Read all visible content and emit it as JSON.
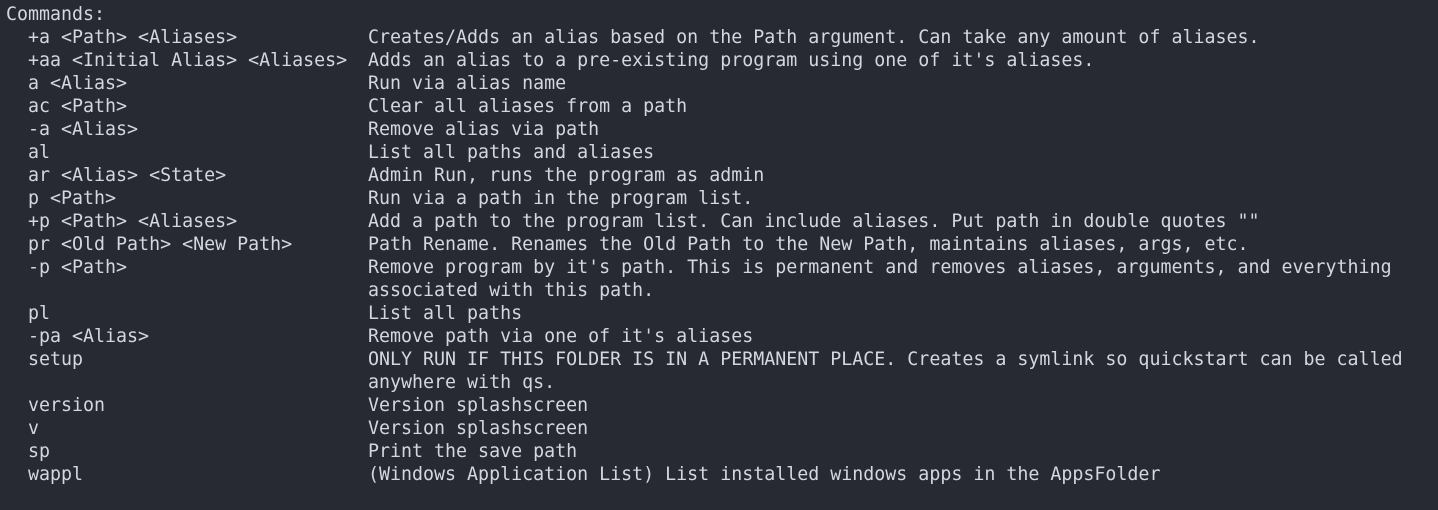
{
  "terminal": {
    "heading": "Commands:",
    "commands": [
      {
        "cmd": "+a <Path> <Aliases>",
        "desc": [
          "Creates/Adds an alias based on the Path argument. Can take any amount of aliases."
        ]
      },
      {
        "cmd": "+aa <Initial Alias> <Aliases>",
        "desc": [
          "Adds an alias to a pre-existing program using one of it's aliases."
        ]
      },
      {
        "cmd": "a <Alias>",
        "desc": [
          "Run via alias name"
        ]
      },
      {
        "cmd": "ac <Path>",
        "desc": [
          "Clear all aliases from a path"
        ]
      },
      {
        "cmd": "-a <Alias>",
        "desc": [
          "Remove alias via path"
        ]
      },
      {
        "cmd": "al",
        "desc": [
          "List all paths and aliases"
        ]
      },
      {
        "cmd": "ar <Alias> <State>",
        "desc": [
          "Admin Run, runs the program as admin"
        ]
      },
      {
        "cmd": "p <Path>",
        "desc": [
          "Run via a path in the program list."
        ]
      },
      {
        "cmd": "+p <Path> <Aliases>",
        "desc": [
          "Add a path to the program list. Can include aliases. Put path in double quotes \"\""
        ]
      },
      {
        "cmd": "pr <Old Path> <New Path>",
        "desc": [
          "Path Rename. Renames the Old Path to the New Path, maintains aliases, args, etc."
        ]
      },
      {
        "cmd": "-p <Path>",
        "desc": [
          "Remove program by it's path. This is permanent and removes aliases, arguments, and everything",
          "associated with this path."
        ]
      },
      {
        "cmd": "pl",
        "desc": [
          "List all paths"
        ]
      },
      {
        "cmd": "-pa <Alias>",
        "desc": [
          "Remove path via one of it's aliases"
        ]
      },
      {
        "cmd": "setup",
        "desc": [
          "ONLY RUN IF THIS FOLDER IS IN A PERMANENT PLACE. Creates a symlink so quickstart can be called",
          "anywhere with qs."
        ]
      },
      {
        "cmd": "version",
        "desc": [
          "Version splashscreen"
        ]
      },
      {
        "cmd": "v",
        "desc": [
          "Version splashscreen"
        ]
      },
      {
        "cmd": "sp",
        "desc": [
          "Print the save path"
        ]
      },
      {
        "cmd": "wappl",
        "desc": [
          "(Windows Application List) List installed windows apps in the AppsFolder"
        ]
      }
    ]
  },
  "colors": {
    "background": "#272a33",
    "foreground": "#d4d7de"
  }
}
